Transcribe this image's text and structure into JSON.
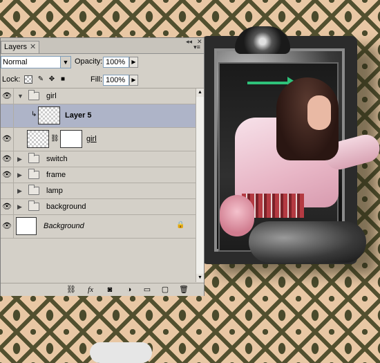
{
  "panel": {
    "tab_label": "Layers",
    "tab_close": "✕",
    "panel_collapse": "◂◂",
    "panel_close": "✕",
    "menu_icon": "▾≡",
    "blend_mode": "Normal",
    "opacity_label": "Opacity:",
    "opacity_value": "100%",
    "fill_label": "Fill:",
    "fill_value": "100%",
    "lock_label": "Lock:",
    "stepper_icon": "▶",
    "dropdown_icon": "▼"
  },
  "layers": [
    {
      "name": "girl",
      "type": "group",
      "expanded": true,
      "visible": true
    },
    {
      "name": "Layer 5",
      "type": "layer",
      "selected": true,
      "clipped": true,
      "visible": false
    },
    {
      "name": "girl",
      "type": "layer-with-mask",
      "visible": true
    },
    {
      "name": "switch",
      "type": "group",
      "expanded": false,
      "visible": true
    },
    {
      "name": "frame",
      "type": "group",
      "expanded": false,
      "visible": true
    },
    {
      "name": "lamp",
      "type": "group",
      "expanded": false,
      "visible": false
    },
    {
      "name": "background",
      "type": "group",
      "expanded": false,
      "visible": true
    },
    {
      "name": "Background",
      "type": "background",
      "visible": true,
      "locked": true
    }
  ],
  "icons": {
    "eye": "👁",
    "expand_open": "▼",
    "expand_closed": "▶",
    "clip_arrow": "↳",
    "chain": "⛓",
    "lock": "🔒",
    "link_layers": "⛓",
    "fx": "fx",
    "add_mask": "◙",
    "adjustment": "◑",
    "new_group": "▭",
    "new_layer": "▢",
    "delete": "🗑",
    "scroll_up": "▲",
    "scroll_down": "▼"
  },
  "colors": {
    "accent_arrow": "#2ec27a",
    "selection": "#aeb4c8",
    "wallpaper_dark": "#4a4a2c",
    "wallpaper_light": "#e8c7a4"
  }
}
